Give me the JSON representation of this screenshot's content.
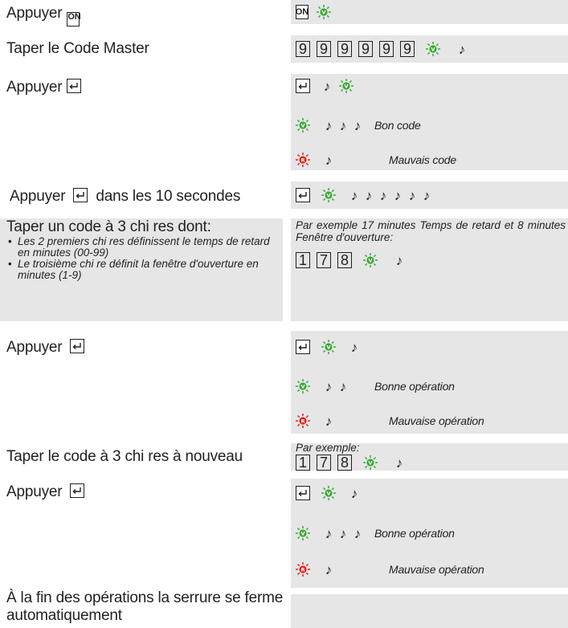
{
  "left": {
    "step1": "Appuyer",
    "step1_key": "ON",
    "step2": "Taper le Code Master",
    "step3": "Appuyer",
    "step4_a": "Appuyer",
    "step4_b": "dans les 10 secondes",
    "step5_title": "Taper un code à 3 chi res dont:",
    "step5_bullets": [
      "Les 2 premiers chi res définissent le temps de retard en minutes (00-99)",
      "Le troisième chi re définit la fenêtre d'ouverture en minutes (1-9)"
    ],
    "step6": "Appuyer",
    "step7": "Taper le code à 3 chi res à nouveau",
    "step8": "Appuyer",
    "step9": "À la fin des opérations la serrure se ferme automatiquement"
  },
  "right": {
    "on_key": "ON",
    "master_digits": [
      "9",
      "9",
      "9",
      "9",
      "9",
      "9"
    ],
    "led_green": "V",
    "led_red": "R",
    "bon_code": "Bon code",
    "mauvais_code": "Mauvais code",
    "example_text": "Par exemple 17 minutes Temps de retard et 8 minutes Fenêtre d'ouverture:",
    "example_digits": [
      "1",
      "7",
      "8"
    ],
    "bonne_operation": "Bonne opération",
    "mauvaise_operation": "Mauvaise opération",
    "par_exemple": "Par exemple:",
    "example_digits_2": [
      "1",
      "7",
      "8"
    ],
    "bonne_operation_2": "Bonne opération",
    "mauvaise_operation_2": "Mauvaise opération"
  },
  "colors": {
    "panel": "#e6e6e7",
    "led_green": "#3aa935",
    "led_red": "#e2231a",
    "text": "#231f20"
  },
  "icons": [
    "enter-key-icon",
    "green-led-icon",
    "red-led-icon",
    "beep-note-icon",
    "on-key-icon"
  ]
}
